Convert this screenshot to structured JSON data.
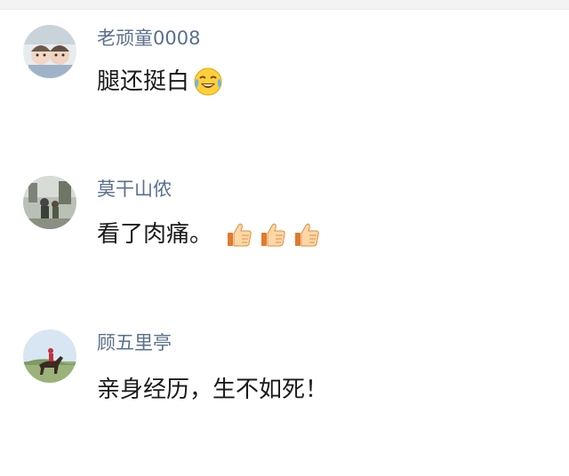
{
  "comments": [
    {
      "username": "老顽童0008",
      "text": "腿还挺白",
      "emoji": [
        "laughing-crying-emoji-icon"
      ]
    },
    {
      "username": "莫干山侬",
      "text": "看了肉痛。",
      "emoji": [
        "thumbs-up-icon",
        "thumbs-up-icon",
        "thumbs-up-icon"
      ]
    },
    {
      "username": "顾五里亭",
      "text": "亲身经历，生不如死！",
      "emoji": []
    }
  ],
  "colors": {
    "username": "#5b6f8e",
    "text": "#1a1a1a",
    "background": "#ffffff"
  }
}
